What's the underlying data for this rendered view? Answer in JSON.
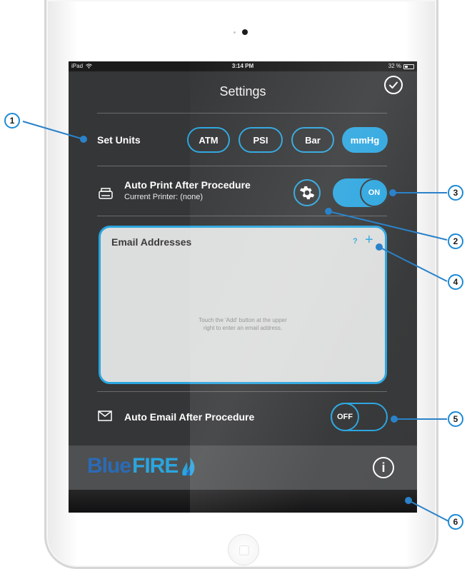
{
  "status_bar": {
    "device": "iPad",
    "time": "3:14 PM",
    "battery": "32 %"
  },
  "header": {
    "title": "Settings",
    "done_icon": "checkmark-icon"
  },
  "units": {
    "label": "Set Units",
    "options": [
      "ATM",
      "PSI",
      "Bar",
      "mmHg"
    ],
    "selected": "mmHg"
  },
  "auto_print": {
    "title": "Auto Print After Procedure",
    "current_printer": "Current Printer: (none)",
    "toggle_state": "ON"
  },
  "email_addresses": {
    "title": "Email Addresses",
    "help_label": "?",
    "add_label": "+",
    "hint_line1": "Touch the 'Add' button at the upper",
    "hint_line2": "right to enter an email address."
  },
  "auto_email": {
    "label": "Auto Email After Procedure",
    "toggle_state": "OFF"
  },
  "footer": {
    "logo_part1": "Blue",
    "logo_part2": "FIRE",
    "info_label": "i"
  },
  "callouts": [
    "1",
    "2",
    "3",
    "4",
    "5",
    "6"
  ],
  "colors": {
    "accent": "#2aa5df",
    "screen_bg": "#353637",
    "panel_bg": "#dcdddd",
    "logo_blue": "#2a6bb6"
  }
}
